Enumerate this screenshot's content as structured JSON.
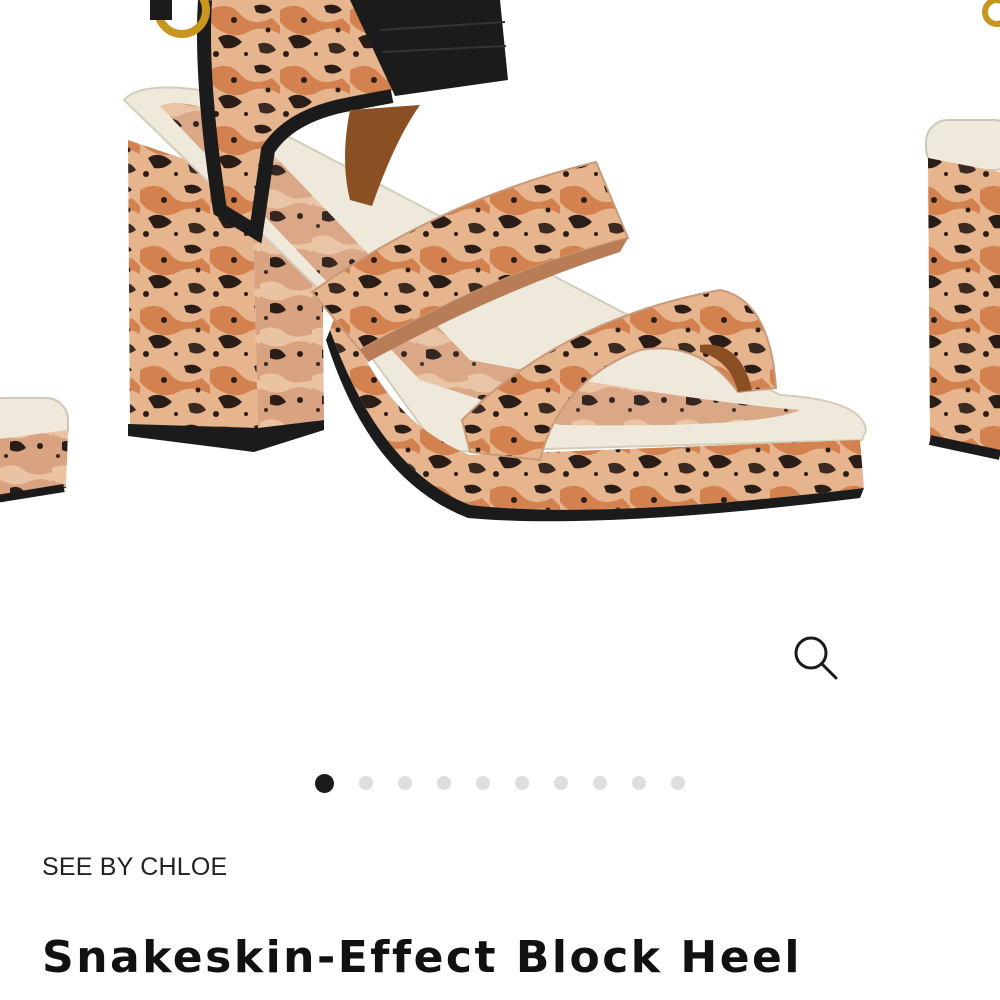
{
  "product": {
    "brand": "SEE BY CHLOE",
    "title": "Snakeskin-Effect Block Heel"
  },
  "gallery": {
    "image_count": 10,
    "active_index": 0,
    "zoom_icon": "magnifier-icon"
  },
  "colors": {
    "snake_light": "#e7b890",
    "snake_mid": "#d98a5a",
    "snake_dark": "#2a1d17",
    "strap_black": "#1b1b1b",
    "sole_cream": "#efe9dc",
    "buckle_gold": "#c8951f",
    "dot_active": "#1a1a1a",
    "dot_inactive": "#dedede"
  }
}
